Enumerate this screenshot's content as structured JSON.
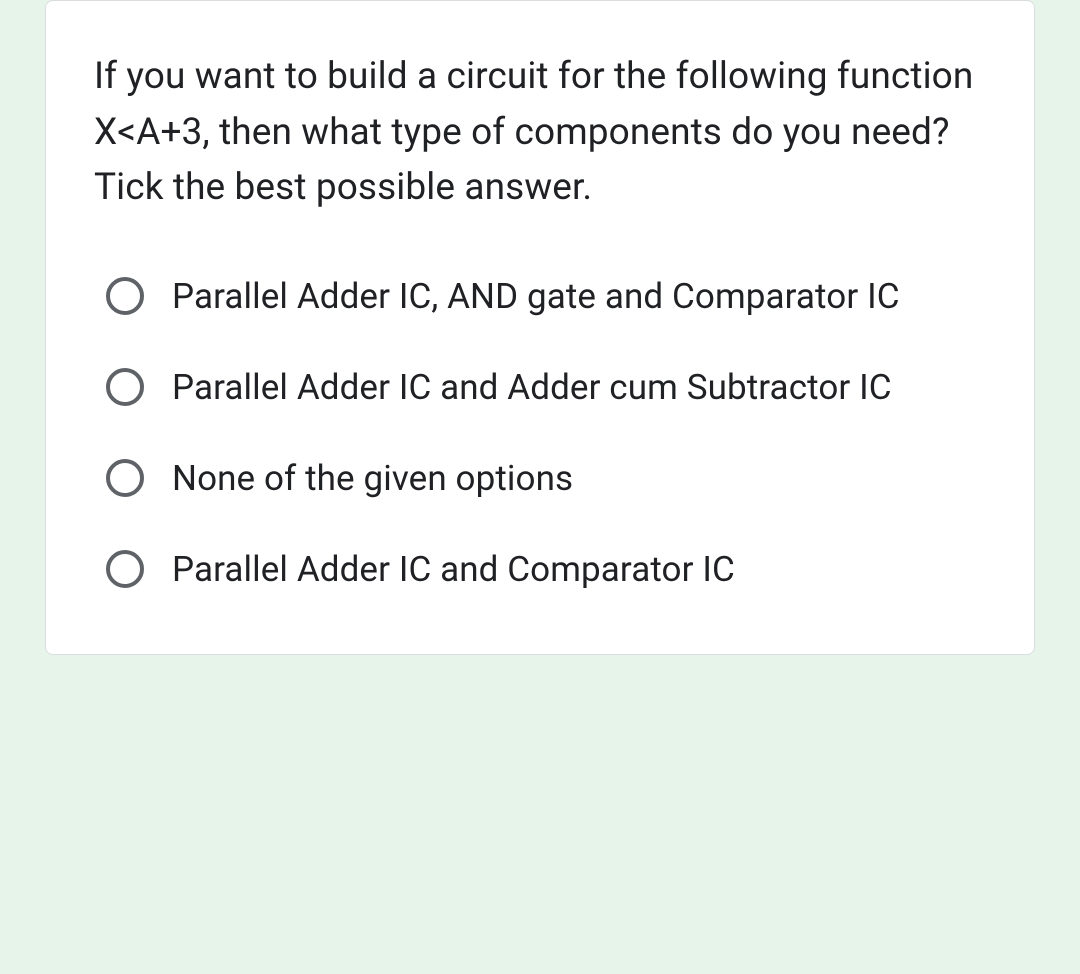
{
  "question": {
    "text": "If you want to build a circuit for the following function X<A+3, then what type of components do you need? Tick the best possible answer."
  },
  "options": [
    {
      "label": "Parallel Adder IC, AND gate and Comparator IC"
    },
    {
      "label": "Parallel Adder IC and Adder cum Subtractor IC"
    },
    {
      "label": "None of the given options"
    },
    {
      "label": "Parallel Adder IC and Comparator IC"
    }
  ]
}
